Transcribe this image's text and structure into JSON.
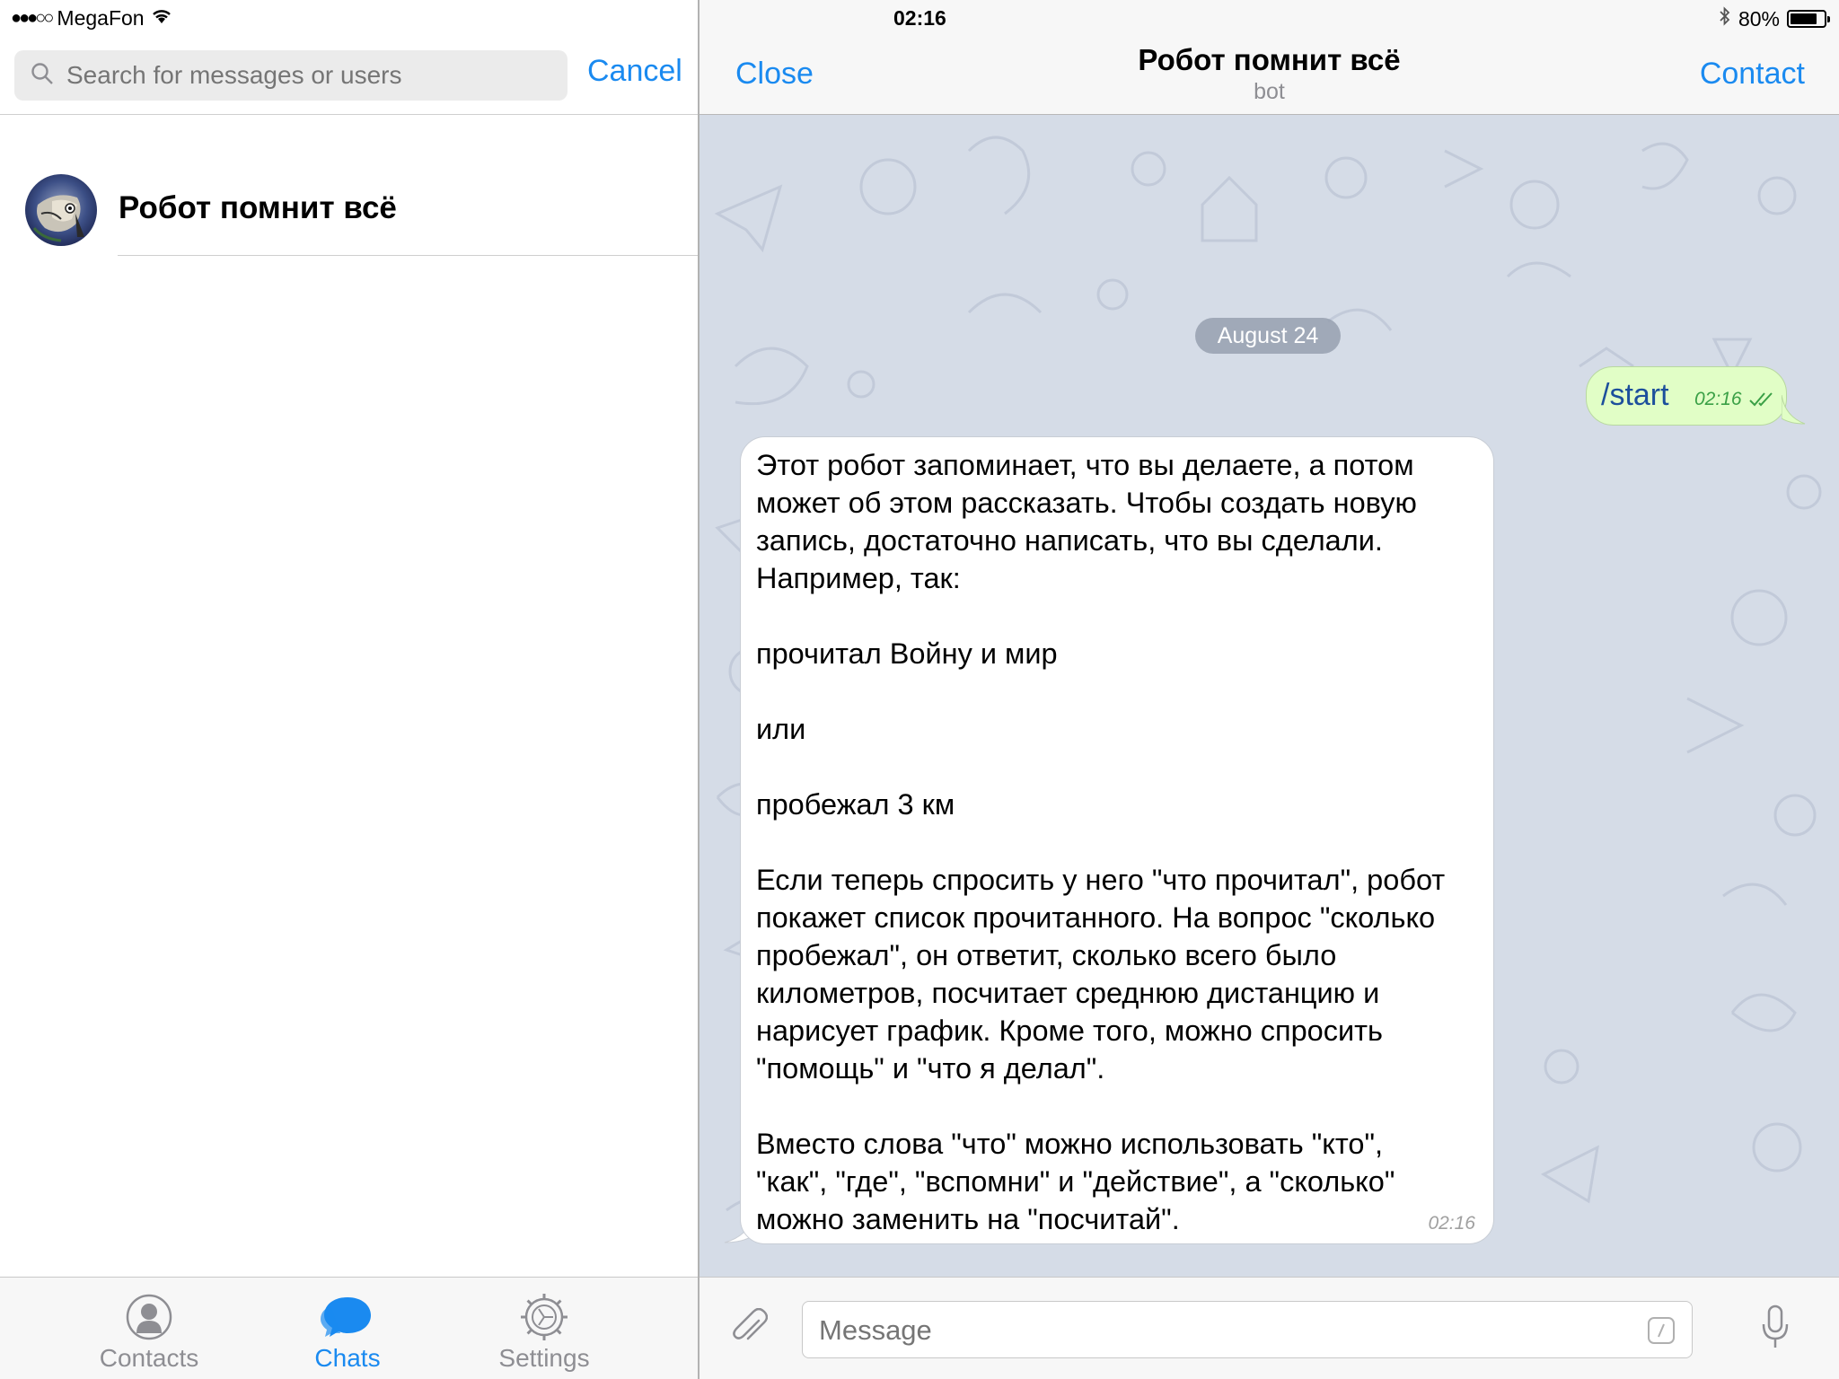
{
  "status_bar": {
    "signal_dots": "●●●○○",
    "carrier": "MegaFon",
    "time": "02:16",
    "battery_percent": "80%",
    "battery_level": 0.8
  },
  "left_panel": {
    "search_placeholder": "Search for messages or users",
    "cancel_label": "Cancel",
    "chat_items": [
      {
        "name": "Робот помнит всё"
      }
    ],
    "tabs": [
      {
        "label": "Contacts",
        "icon": "contacts-icon",
        "active": false
      },
      {
        "label": "Chats",
        "icon": "chats-icon",
        "active": true
      },
      {
        "label": "Settings",
        "icon": "settings-icon",
        "active": false
      }
    ]
  },
  "chat": {
    "close_label": "Close",
    "contact_label": "Contact",
    "title": "Робот помнит всё",
    "subtitle": "bot",
    "date_separator": "August 24",
    "messages": [
      {
        "direction": "outgoing",
        "text": "/start",
        "time": "02:16",
        "status": "read"
      },
      {
        "direction": "incoming",
        "text": "Этот робот запоминает, что вы делаете, а потом\nможет об этом рассказать. Чтобы создать новую\nзапись, достаточно написать, что вы сделали.\nНапример, так:\n\nпрочитал Войну и мир\n\nили\n\nпробежал 3 км\n\nЕсли теперь спросить у него \"что прочитал\", робот\nпокажет список прочитанного. На вопрос \"сколько\nпробежал\", он ответит, сколько всего было\nкилометров, посчитает среднюю дистанцию и\nнарисует график. Кроме того, можно спросить\n\"помощь\" и \"что я делал\".\n\nВместо слова \"что\" можно использовать \"кто\",\n\"как\", \"где\", \"вспомни\" и \"действие\", а \"сколько\"\nможно заменить на \"посчитай\".",
        "time": "02:16"
      }
    ],
    "input_placeholder": "Message"
  },
  "colors": {
    "accent": "#1a8af0",
    "wallpaper": "#d5dce7",
    "outgoing_bubble": "#e1fec6",
    "read_check": "#3aa046"
  }
}
